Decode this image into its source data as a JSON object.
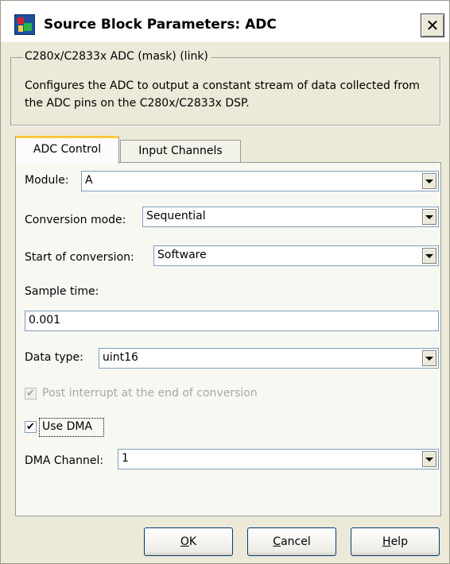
{
  "window": {
    "title": "Source Block Parameters: ADC",
    "close_glyph": "✕"
  },
  "group": {
    "legend": "C280x/C2833x ADC (mask) (link)",
    "description": "Configures the ADC to output a constant stream of data collected from the ADC pins on the C280x/C2833x DSP."
  },
  "tabs": [
    {
      "label": "ADC Control",
      "active": true
    },
    {
      "label": "Input Channels",
      "active": false
    }
  ],
  "fields": {
    "module": {
      "label": "Module:",
      "value": "A"
    },
    "conversion_mode": {
      "label": "Conversion mode:",
      "value": "Sequential"
    },
    "start_of_conversion": {
      "label": "Start of conversion:",
      "value": "Software"
    },
    "sample_time": {
      "label": "Sample time:",
      "value": "0.001"
    },
    "data_type": {
      "label": "Data type:",
      "value": "uint16"
    },
    "post_interrupt": {
      "label": "Post interrupt at the end of conversion",
      "checked": true,
      "enabled": false
    },
    "use_dma": {
      "label": "Use DMA",
      "checked": true,
      "enabled": true
    },
    "dma_channel": {
      "label": "DMA Channel:",
      "value": "1"
    }
  },
  "buttons": {
    "ok": {
      "mnemonic": "O",
      "rest": "K"
    },
    "cancel": {
      "mnemonic": "C",
      "rest": "ancel"
    },
    "help": {
      "mnemonic": "H",
      "rest": "elp"
    }
  },
  "check_glyph": "✔",
  "colors": {
    "dialog_bg": "#ece9d8",
    "tab_accent": "#ffc83c",
    "field_border": "#7f9db9",
    "disabled_text": "#a8a8a0"
  }
}
